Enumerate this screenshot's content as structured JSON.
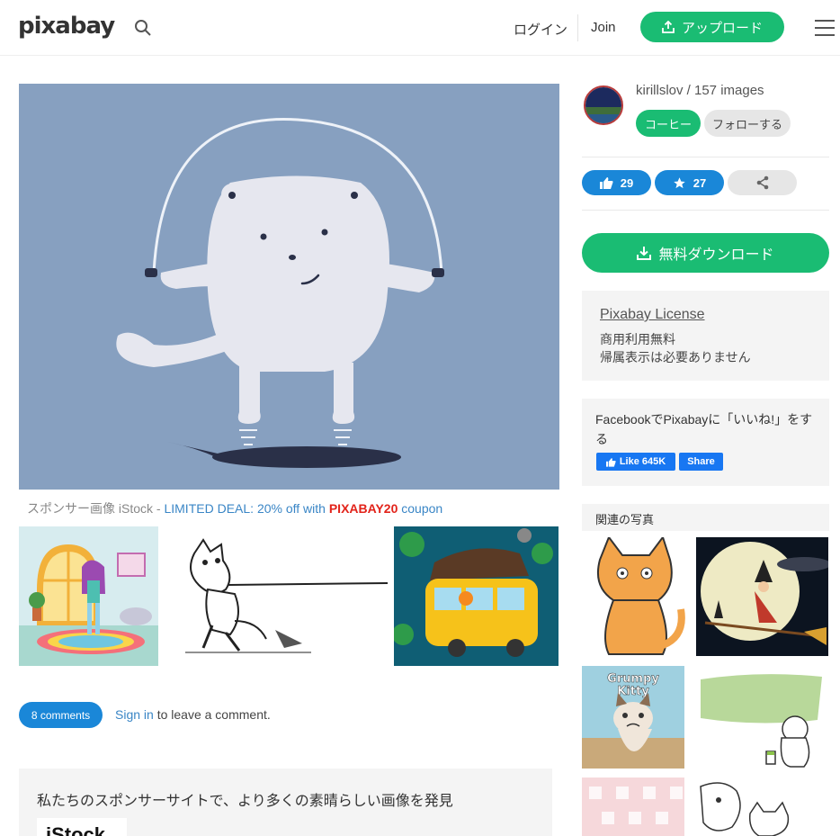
{
  "header": {
    "logo": "pixabay",
    "login": "ログイン",
    "join": "Join",
    "upload": "アップロード",
    "search_icon": "search-icon",
    "menu_icon": "hamburger-menu-icon"
  },
  "image": {
    "alt_subject": "polar bear skipping rope",
    "background_color": "#87a0c0"
  },
  "sponsor": {
    "prefix": "スポンサー画像 iStock - ",
    "deal": "LIMITED DEAL: 20% off with ",
    "code": "PIXABAY20",
    "suffix": " coupon"
  },
  "comments": {
    "count_label": "8 comments",
    "sign_in": "Sign in",
    "sign_in_suffix": " to leave a comment."
  },
  "discover": {
    "title": "私たちのスポンサーサイトで、より多くの素晴らしい画像を発見",
    "logo_text": "iStock"
  },
  "author": {
    "line": "kirillslov / 157 images",
    "coffee": "コーヒー",
    "follow": "フォローする"
  },
  "stats": {
    "likes": "29",
    "favorites": "27",
    "like_icon": "thumbs-up-icon",
    "favorite_icon": "star-icon",
    "share_icon": "share-icon"
  },
  "download": {
    "label": "無料ダウンロード"
  },
  "license": {
    "title": "Pixabay License",
    "line1": "商用利用無料",
    "line2": "帰属表示は必要ありません"
  },
  "facebook": {
    "text": "FacebookでPixabayに「いいね!」をする",
    "like": "Like 645K",
    "share": "Share"
  },
  "related": {
    "title": "関連の写真",
    "grumpy": "Grumpy Kitty"
  },
  "colors": {
    "accent_green": "#1abc73",
    "accent_blue": "#1a87d8",
    "coupon_red": "#e2231a"
  }
}
